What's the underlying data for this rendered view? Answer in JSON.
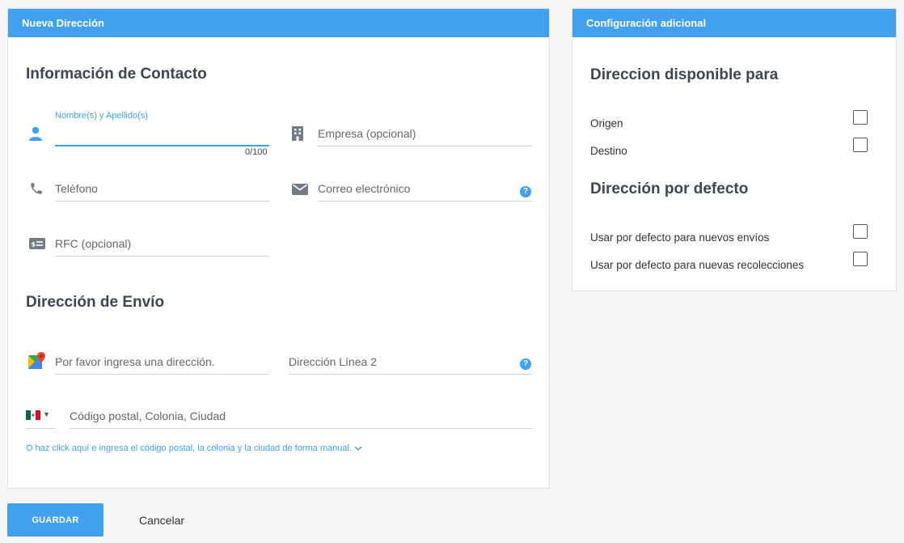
{
  "main": {
    "header": "Nueva Dirección",
    "contact_title": "Información de Contacto",
    "name": {
      "label": "Nombre(s) y Apellido(s)",
      "counter": "0/100"
    },
    "company": {
      "placeholder": "Empresa (opcional)"
    },
    "phone": {
      "placeholder": "Teléfono"
    },
    "email": {
      "placeholder": "Correo electrónico",
      "help": "?"
    },
    "rfc": {
      "placeholder": "RFC (opcional)"
    },
    "shipping_title": "Dirección de Envío",
    "address": {
      "placeholder": "Por favor ingresa una dirección."
    },
    "address2": {
      "placeholder": "Dirección Línea 2",
      "help": "?"
    },
    "country": {
      "flag": "mexico-flag",
      "caret": "▼"
    },
    "postal": {
      "placeholder": "Código postal, Colonia, Ciudad"
    },
    "manual_link": "O haz click aquí e ingresa el código postal, la colonia y la ciudad de forma manual.",
    "manual_link_icon": "chevron-down-icon"
  },
  "side": {
    "header": "Configuración adicional",
    "available_title": "Direccion disponible para",
    "available_options": [
      "Origen",
      "Destino"
    ],
    "default_title": "Dirección por defecto",
    "default_options": [
      "Usar por defecto para nuevos envíos",
      "Usar por defecto para nuevas recolecciones"
    ]
  },
  "actions": {
    "save": "GUARDAR",
    "cancel": "Cancelar"
  },
  "colors": {
    "accent": "#42a0f0",
    "heading": "#3d4653",
    "icon_gray": "#737b86"
  }
}
